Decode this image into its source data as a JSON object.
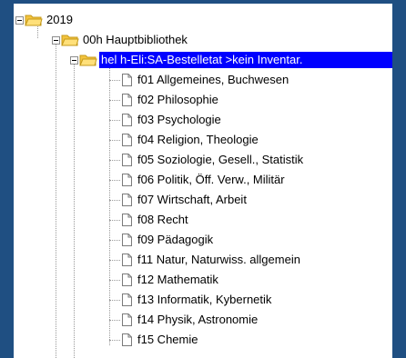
{
  "tree": {
    "root": {
      "label": "2019",
      "expanded": true
    },
    "library": {
      "label": "00h  Hauptbibliothek",
      "expanded": true
    },
    "selected": {
      "label": "hel  h-Eli:SA-Bestelletat >kein Inventar.",
      "expanded": true
    },
    "items": [
      {
        "label": "f01  Allgemeines, Buchwesen"
      },
      {
        "label": "f02  Philosophie"
      },
      {
        "label": "f03  Psychologie"
      },
      {
        "label": "f04  Religion, Theologie"
      },
      {
        "label": "f05  Soziologie, Gesell., Statistik"
      },
      {
        "label": "f06  Politik, Öff. Verw., Militär"
      },
      {
        "label": "f07  Wirtschaft, Arbeit"
      },
      {
        "label": "f08  Recht"
      },
      {
        "label": "f09  Pädagogik"
      },
      {
        "label": "f11  Natur, Naturwiss. allgemein"
      },
      {
        "label": "f12  Mathematik"
      },
      {
        "label": "f13  Informatik, Kybernetik"
      },
      {
        "label": "f14  Physik, Astronomie"
      },
      {
        "label": "f15  Chemie"
      }
    ]
  },
  "colors": {
    "background": "#1f4f82",
    "selection": "#0000ff",
    "folder": "#f3c33d"
  }
}
